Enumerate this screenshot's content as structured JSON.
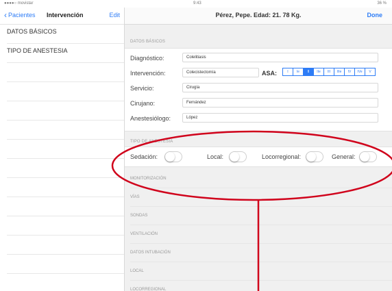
{
  "status_bar": {
    "carrier": "●●●●○ movistar",
    "time": "9:43",
    "battery": "36 %"
  },
  "left": {
    "back_label": "Pacientes",
    "title": "Intervención",
    "edit_label": "Edit",
    "items": [
      {
        "label": "DATOS BÁSICOS"
      },
      {
        "label": "TIPO DE ANESTESIA"
      }
    ]
  },
  "right": {
    "title": "Pérez, Pepe. Edad: 21. 78 Kg.",
    "done_label": "Done",
    "datos": {
      "header": "DATOS BÁSICOS",
      "fields": [
        {
          "label": "Diagnóstico:",
          "value": "Colelitiasis"
        },
        {
          "label": "Intervención:",
          "value": "Colecistectomía"
        },
        {
          "label": "Servicio:",
          "value": "Cirugía"
        },
        {
          "label": "Cirujano:",
          "value": "Fernández"
        },
        {
          "label": "Anestesiólogo:",
          "value": "López"
        }
      ],
      "asa": {
        "label": "ASA:",
        "options": [
          "I",
          "Ie",
          "II",
          "IIe",
          "III",
          "IIIe",
          "IV",
          "IVe",
          "V"
        ],
        "selected": "II"
      }
    },
    "tipo": {
      "header": "TIPO DE ANESTESIA",
      "toggles": [
        {
          "label": "Sedación:",
          "on": false
        },
        {
          "label": "Local:",
          "on": false
        },
        {
          "label": "Locorregional:",
          "on": false
        },
        {
          "label": "General:",
          "on": false
        }
      ]
    },
    "sections": [
      "MONITORIZACIÓN",
      "VÍAS",
      "SONDAS",
      "VENTILACIÓN",
      "DATOS INTUBACIÓN",
      "LOCAL",
      "LOCORREGIONAL"
    ]
  },
  "colors": {
    "accent": "#2d7cf6",
    "annotation": "#d0021b"
  }
}
